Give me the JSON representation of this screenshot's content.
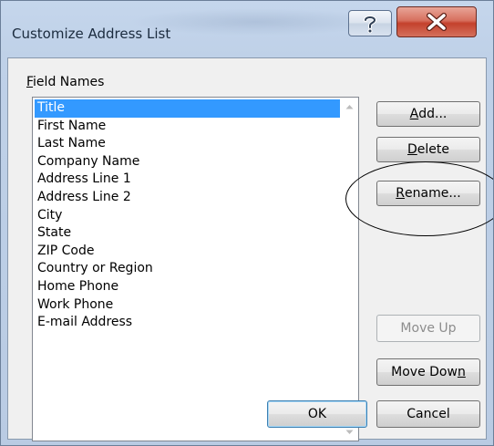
{
  "window": {
    "title": "Customize Address List",
    "help_label": "?",
    "close_label": "X"
  },
  "field_names": {
    "label_mnemonic": "F",
    "label_rest": "ield Names",
    "items": [
      "Title",
      "First Name",
      "Last Name",
      "Company Name",
      "Address Line 1",
      "Address Line 2",
      "City",
      "State",
      "ZIP Code",
      "Country or Region",
      "Home Phone",
      "Work Phone",
      "E-mail Address"
    ],
    "selected_index": 0
  },
  "buttons": {
    "add": {
      "mnemonic": "A",
      "rest": "dd..."
    },
    "delete": {
      "mnemonic": "D",
      "rest": "elete"
    },
    "rename": {
      "mnemonic": "R",
      "rest": "ename..."
    },
    "move_up": {
      "label": "Move Up"
    },
    "move_down": {
      "before": "Move Dow",
      "mnemonic": "n"
    },
    "ok": {
      "label": "OK"
    },
    "cancel": {
      "label": "Cancel"
    }
  }
}
